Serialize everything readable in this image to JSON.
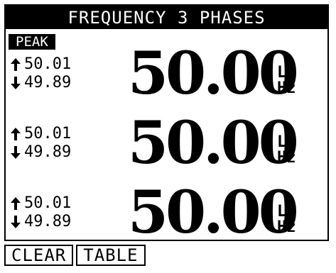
{
  "screen": {
    "title": "FREQUENCY 3 PHASES",
    "peak_label": "PEAK"
  },
  "phases": [
    {
      "max": "50.01",
      "min": "49.89",
      "value": "50.00",
      "phase": "L1",
      "unit": "Hz"
    },
    {
      "max": "50.01",
      "min": "49.89",
      "value": "50.00",
      "phase": "L2",
      "unit": "Hz"
    },
    {
      "max": "50.01",
      "min": "49.89",
      "value": "50.00",
      "phase": "L3",
      "unit": "Hz"
    }
  ],
  "softkeys": {
    "clear": "CLEAR",
    "table": "TABLE"
  },
  "icons": {
    "up": "arrow-up-icon",
    "down": "arrow-down-icon"
  },
  "colors": {
    "foreground": "#000000",
    "background": "#ffffff"
  }
}
